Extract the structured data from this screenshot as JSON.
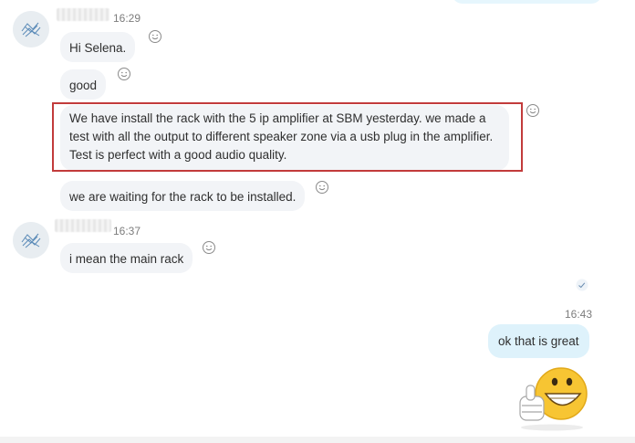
{
  "messages": {
    "group1": {
      "time": "16:29",
      "m1": "Hi Selena.",
      "m2": "good",
      "m3": "We have install the rack with the 5 ip amplifier at SBM yesterday. we made a test with all the output to different speaker zone via a usb plug in the amplifier. Test is perfect with a good audio quality.",
      "m4": "we are waiting for the rack to be installed."
    },
    "group2": {
      "time": "16:37",
      "m1": "i mean the main rack"
    },
    "outgoing": {
      "time": "16:43",
      "m1": "ok that is great"
    }
  },
  "icons": {
    "reaction": "smiley-reaction-icon",
    "read_receipt": "read-receipt-icon",
    "sticker": "grinning-thumbs-up-emoji",
    "avatar": "contact-avatar-icon"
  },
  "colors": {
    "highlight": "#c23b3b",
    "incoming_bubble": "#f2f4f7",
    "outgoing_bubble": "#def2fb",
    "emoji_yellow": "#f7c533"
  }
}
